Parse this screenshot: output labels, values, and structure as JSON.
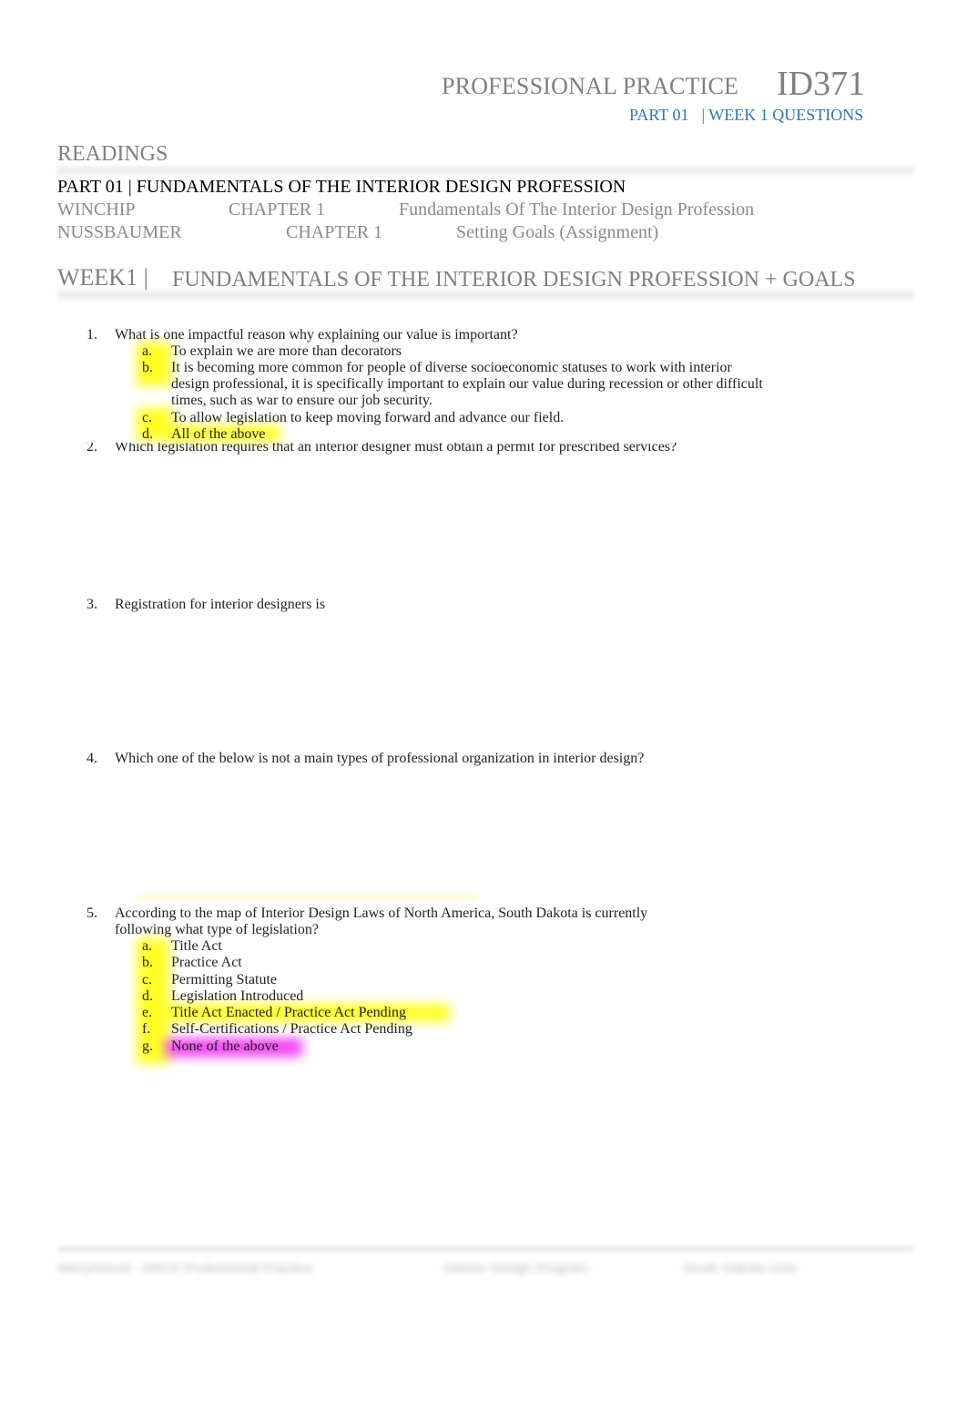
{
  "header": {
    "title": "PROFESSIONAL PRACTICE",
    "course_code": "ID371",
    "part": "PART 01",
    "subtitle": "| WEEK 1 QUESTIONS"
  },
  "readings": {
    "heading": "READINGS",
    "part_line": "PART 01 | FUNDAMENTALS OF THE INTERIOR DESIGN PROFESSION",
    "rows": [
      {
        "author": "WINCHIP",
        "chapter": "CHAPTER 1",
        "title": "Fundamentals Of The Interior Design Profession"
      },
      {
        "author": "NUSSBAUMER",
        "chapter": "CHAPTER 1",
        "title": "Setting Goals (Assignment)"
      }
    ]
  },
  "week": {
    "label": "WEEK1 |",
    "title": "FUNDAMENTALS OF THE INTERIOR DESIGN PROFESSION + GOALS"
  },
  "questions": [
    {
      "number": "1.",
      "text": "What is one impactful reason why explaining our value is important?",
      "options": [
        {
          "letter": "a.",
          "text": "To explain we are more than decorators"
        },
        {
          "letter": "b.",
          "text": "It is becoming more common for people of diverse socioeconomic statuses to work with interior design professional, it is specifically important to explain our value during recession or other difficult times, such as war to ensure our job security."
        },
        {
          "letter": "c.",
          "text": "To allow legislation to keep moving forward and advance our field."
        },
        {
          "letter": "d.",
          "text": "All of the above",
          "highlight": "#ffff00"
        }
      ]
    },
    {
      "number": "2.",
      "text": "Which legislation requires that an interior designer must obtain a permit for prescribed services?"
    },
    {
      "number": "3.",
      "text": "Registration for interior designers is"
    },
    {
      "number": "4.",
      "text": "Which one of the below is not a main types of professional organization in interior design?"
    },
    {
      "number": "5.",
      "text": "According to the map of Interior Design Laws of North America, South Dakota is currently following what type of legislation?",
      "options": [
        {
          "letter": "a.",
          "text": "Title Act"
        },
        {
          "letter": "b.",
          "text": "Practice Act"
        },
        {
          "letter": "c.",
          "text": "Permitting Statute"
        },
        {
          "letter": "d.",
          "text": "Legislation Introduced"
        },
        {
          "letter": "e.",
          "text": "Title Act Enacted / Practice Act Pending",
          "highlight": "#ffff00"
        },
        {
          "letter": "f.",
          "text": "Self-Certifications / Practice Act Pending"
        },
        {
          "letter": "g.",
          "text": "None of the above",
          "highlight": "#ee22ee"
        }
      ]
    }
  ],
  "footer": {
    "items": [
      "Merrymount - ARCH   Professional Practice",
      "Interior Design Program",
      "South Dakota Univ"
    ]
  },
  "colors": {
    "heading_gray": "#7f7f7f",
    "accent_blue": "#2e74b5",
    "highlight_yellow": "#ffff00",
    "highlight_magenta": "#ee22ee"
  }
}
